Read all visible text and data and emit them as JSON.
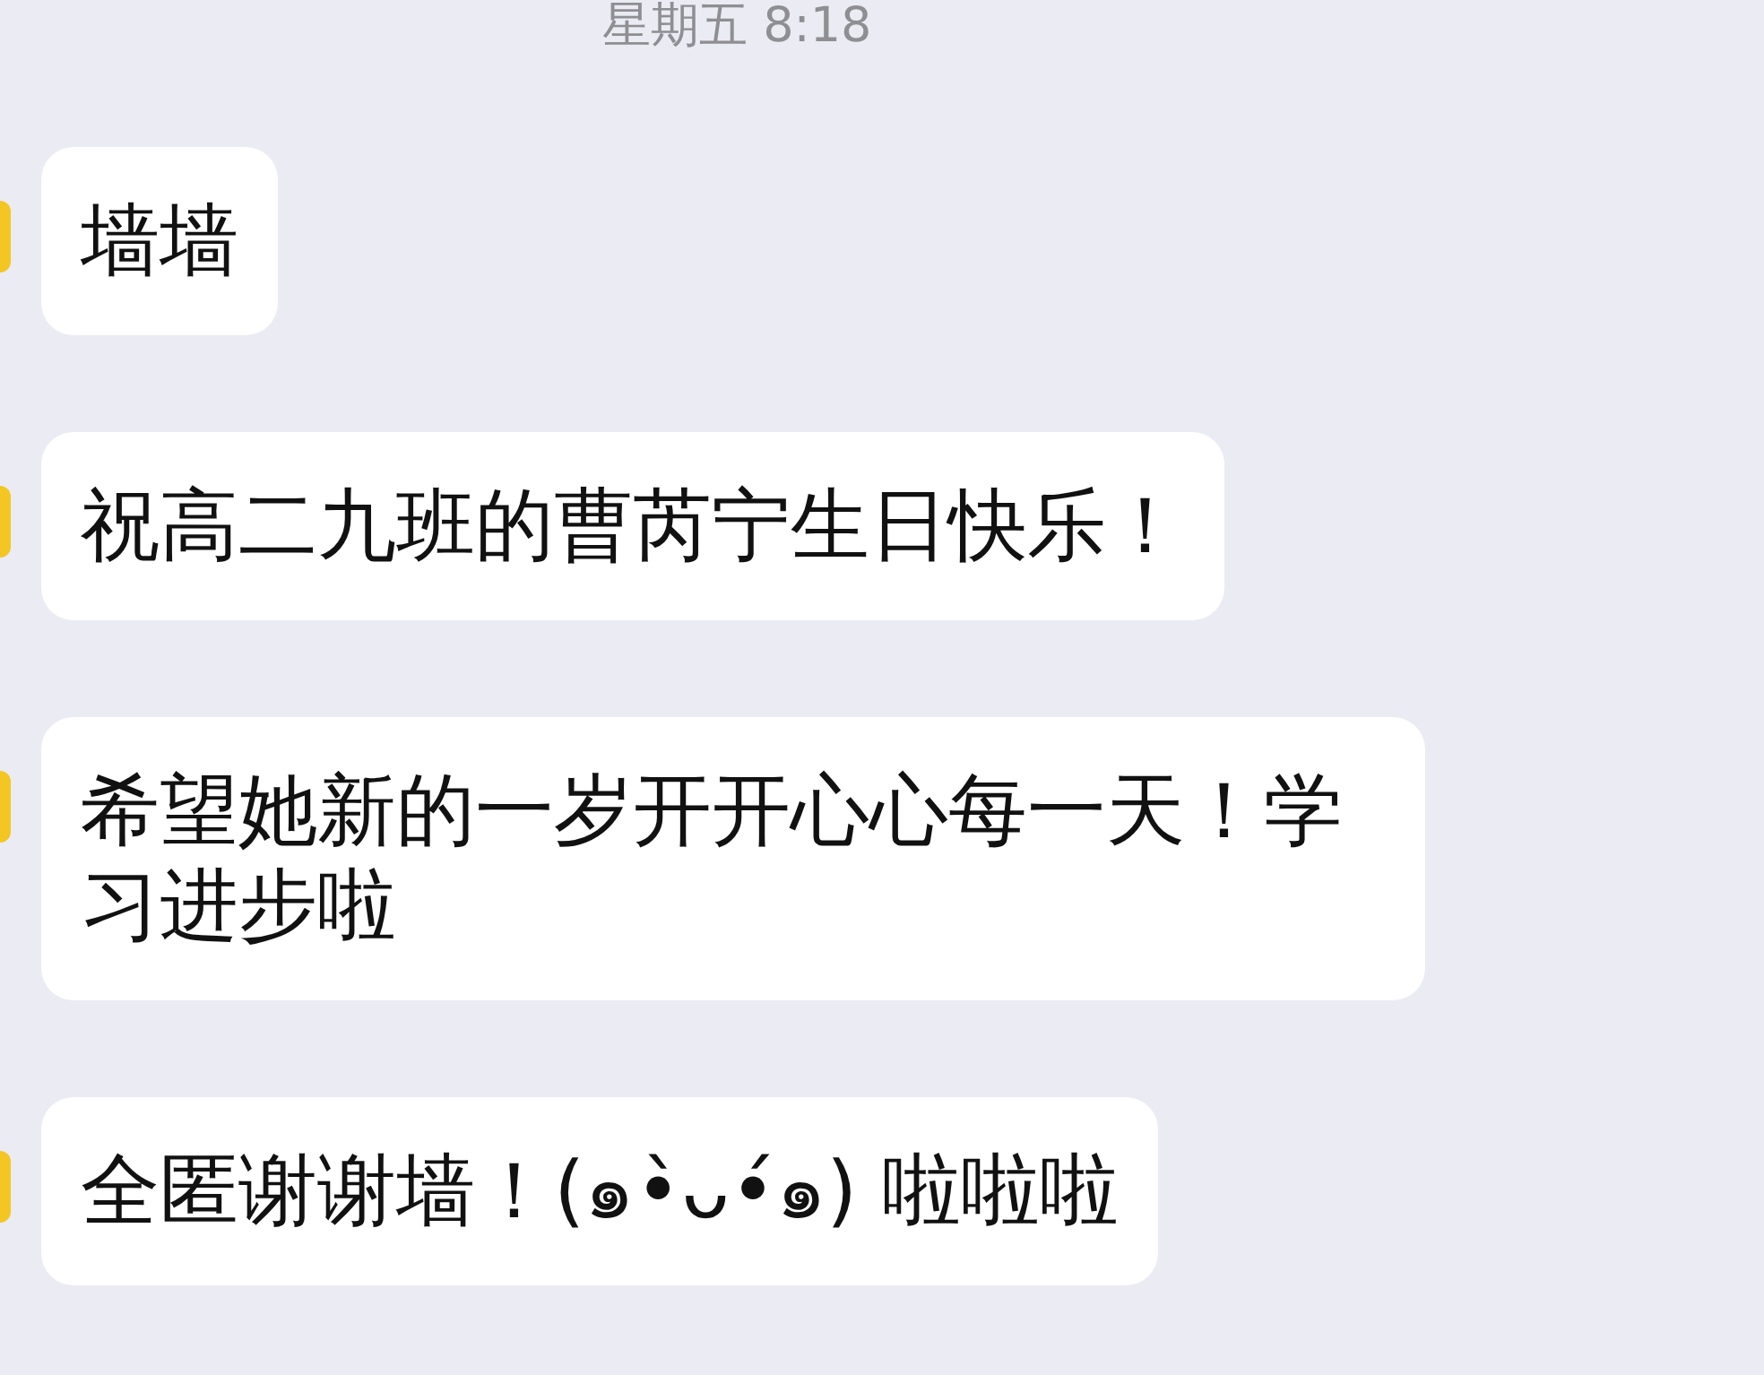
{
  "timestamp": "星期五 8:18",
  "messages": [
    {
      "text": "墙墙"
    },
    {
      "text": "祝高二九班的曹芮宁生日快乐！"
    },
    {
      "text": "希望她新的一岁开开心心每一天！学习进步啦"
    },
    {
      "text": "全匿谢谢墙！(๑•̀ᴗ•́๑) 啦啦啦"
    }
  ]
}
